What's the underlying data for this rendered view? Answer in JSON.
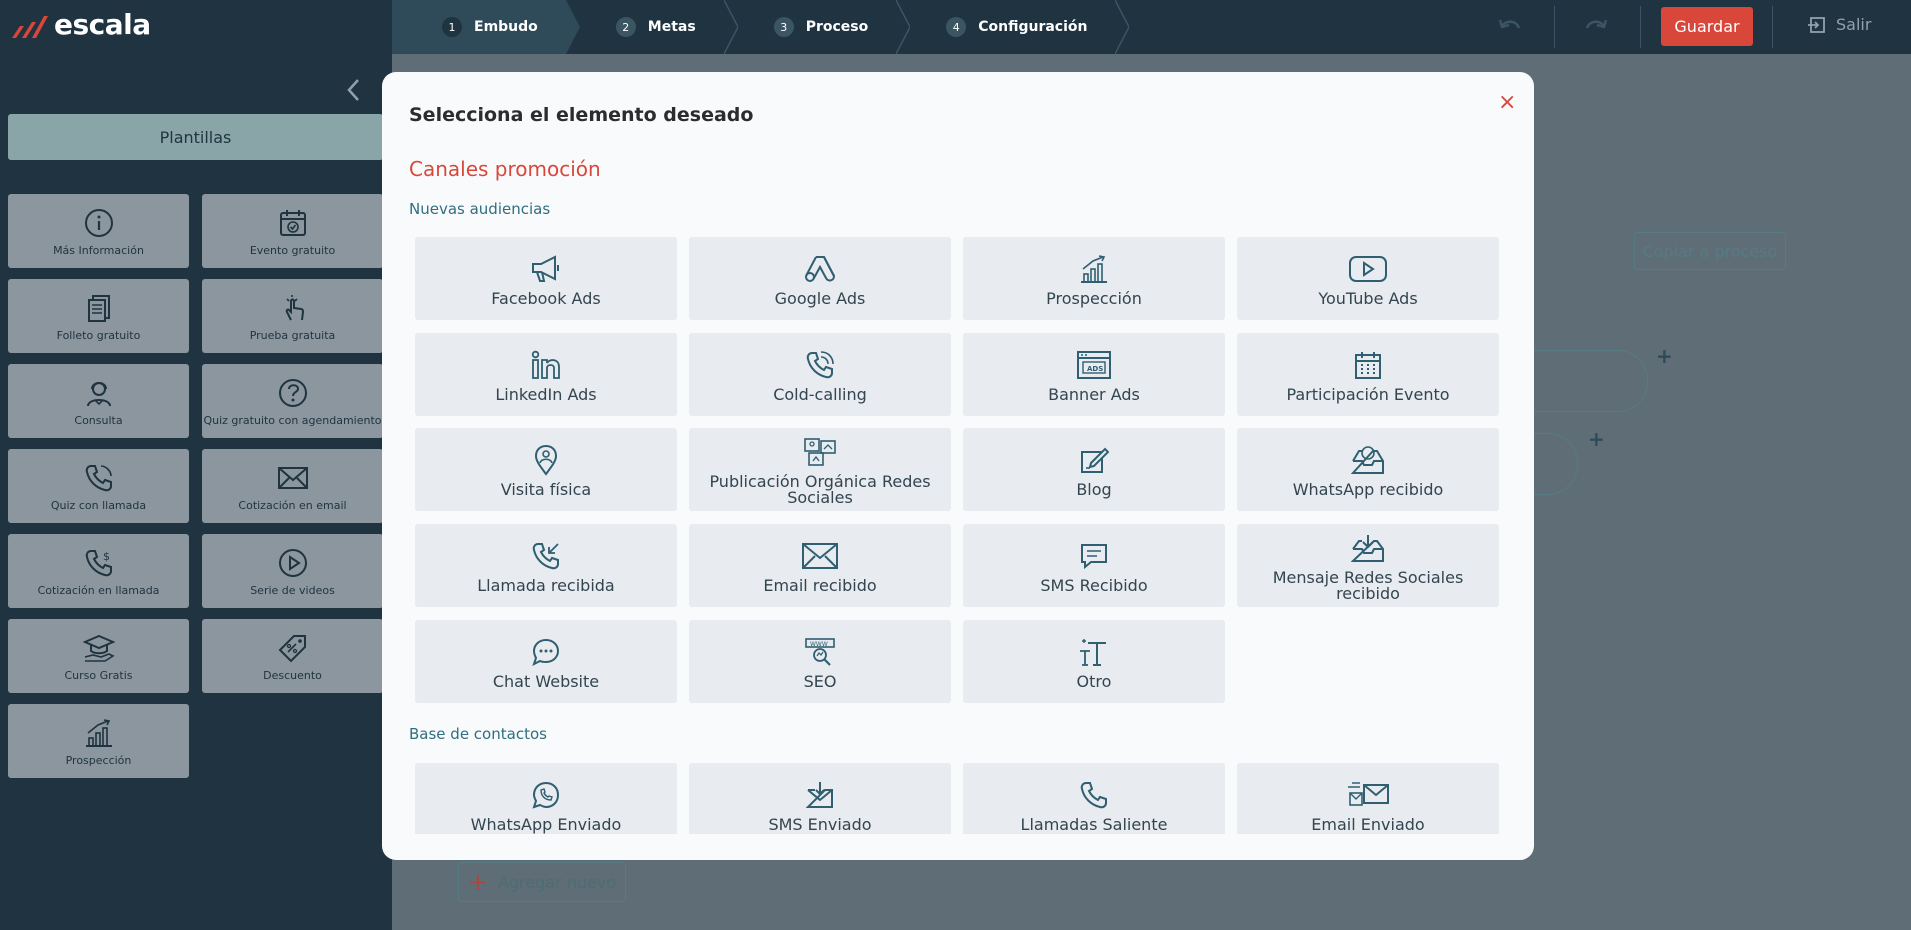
{
  "app": {
    "logo_text": "escala"
  },
  "steps": [
    {
      "num": "1",
      "label": "Embudo"
    },
    {
      "num": "2",
      "label": "Metas"
    },
    {
      "num": "3",
      "label": "Proceso"
    },
    {
      "num": "4",
      "label": "Configuración"
    }
  ],
  "toolbar": {
    "save_label": "Guardar",
    "exit_label": "Salir"
  },
  "sidebar": {
    "templates_label": "Plantillas",
    "tiles": [
      {
        "label": "Más Información",
        "icon": "info-icon"
      },
      {
        "label": "Evento gratuito",
        "icon": "calendar-check-icon"
      },
      {
        "label": "Folleto gratuito",
        "icon": "brochure-icon"
      },
      {
        "label": "Prueba gratuita",
        "icon": "pointer-icon"
      },
      {
        "label": "Consulta",
        "icon": "consultant-icon"
      },
      {
        "label": "Quiz gratuito con agendamiento",
        "icon": "question-icon"
      },
      {
        "label": "Quiz con llamada",
        "icon": "phone-call-icon"
      },
      {
        "label": "Cotización en email",
        "icon": "envelope-icon"
      },
      {
        "label": "Cotización en llamada",
        "icon": "phone-dollar-icon"
      },
      {
        "label": "Serie de videos",
        "icon": "play-icon"
      },
      {
        "label": "Curso Gratis",
        "icon": "graduation-icon"
      },
      {
        "label": "Descuento",
        "icon": "discount-tag-icon"
      },
      {
        "label": "Prospección",
        "icon": "chart-growth-icon"
      }
    ]
  },
  "background": {
    "copy_label": "Copiar a proceso",
    "add_label": "Agregar nuevo"
  },
  "modal": {
    "title": "Selecciona el elemento deseado",
    "close": "×",
    "section_title": "Canales promoción",
    "groups": [
      {
        "title": "Nuevas audiencias",
        "items": [
          {
            "label": "Facebook Ads",
            "icon": "megaphone-icon"
          },
          {
            "label": "Google Ads",
            "icon": "google-ads-icon"
          },
          {
            "label": "Prospección",
            "icon": "chart-growth-icon"
          },
          {
            "label": "YouTube Ads",
            "icon": "youtube-icon"
          },
          {
            "label": "LinkedIn Ads",
            "icon": "linkedin-icon"
          },
          {
            "label": "Cold-calling",
            "icon": "phone-ring-icon"
          },
          {
            "label": "Banner Ads",
            "icon": "banner-ads-icon"
          },
          {
            "label": "Participación Evento",
            "icon": "calendar-icon"
          },
          {
            "label": "Visita física",
            "icon": "location-pin-icon"
          },
          {
            "label": "Publicación Orgánica Redes Sociales",
            "icon": "social-post-icon"
          },
          {
            "label": "Blog",
            "icon": "blog-pencil-icon"
          },
          {
            "label": "WhatsApp recibido",
            "icon": "inbox-whatsapp-icon"
          },
          {
            "label": "Llamada recibida",
            "icon": "phone-incoming-icon"
          },
          {
            "label": "Email recibido",
            "icon": "envelope-icon"
          },
          {
            "label": "SMS Recibido",
            "icon": "chat-bubble-icon"
          },
          {
            "label": "Mensaje Redes Sociales recibido",
            "icon": "inbox-download-icon"
          },
          {
            "label": "Chat Website",
            "icon": "chat-dots-icon"
          },
          {
            "label": "SEO",
            "icon": "seo-icon"
          },
          {
            "label": "Otro",
            "icon": "text-icon"
          }
        ]
      },
      {
        "title": "Base de contactos",
        "items": [
          {
            "label": "WhatsApp Enviado",
            "icon": "whatsapp-icon"
          },
          {
            "label": "SMS Enviado",
            "icon": "sms-sent-icon"
          },
          {
            "label": "Llamadas Saliente",
            "icon": "phone-icon"
          },
          {
            "label": "Email Enviado",
            "icon": "email-sent-icon"
          }
        ]
      }
    ]
  },
  "colors": {
    "brand_red": "#d9473b",
    "nav_dark": "#1f3340",
    "icon_teal": "#2f5f70",
    "card_bg": "#e8ebef"
  }
}
